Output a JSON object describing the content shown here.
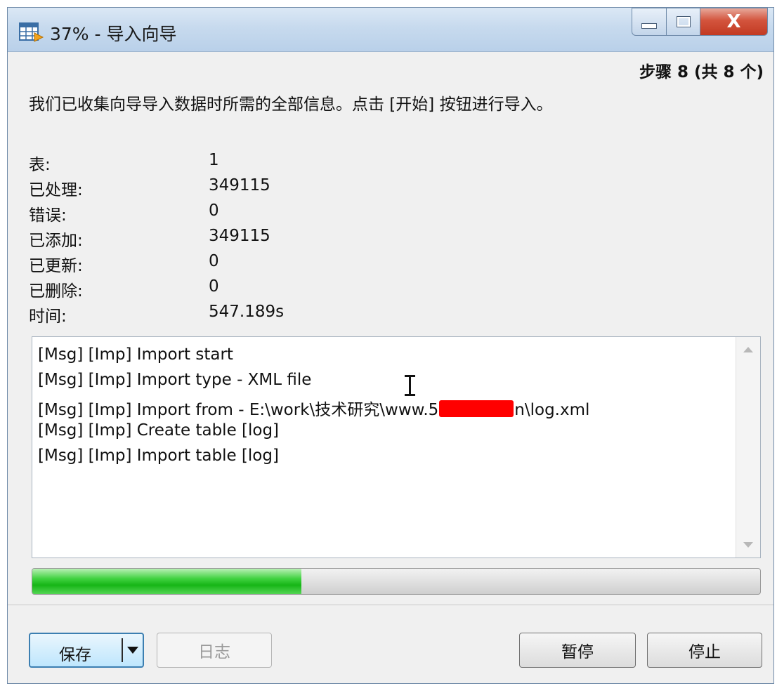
{
  "window": {
    "title": "37% - 导入向导",
    "app_icon": "grid-table-icon",
    "close_label": "X"
  },
  "wizard": {
    "step_label": "步骤 8 (共 8 个)",
    "description": "我们已收集向导导入数据时所需的全部信息。点击 [开始] 按钮进行导入。"
  },
  "stats": [
    {
      "label": "表:",
      "value": "1"
    },
    {
      "label": "已处理:",
      "value": "349115"
    },
    {
      "label": "错误:",
      "value": "0"
    },
    {
      "label": "已添加:",
      "value": "349115"
    },
    {
      "label": "已更新:",
      "value": "0"
    },
    {
      "label": "已删除:",
      "value": "0"
    },
    {
      "label": "时间:",
      "value": "547.189s"
    }
  ],
  "log": {
    "lines": [
      "[Msg] [Imp] Import start",
      "[Msg] [Imp] Import type - XML file",
      "[Msg] [Imp] Import from - E:\\work\\技术研究\\www.5",
      "[Msg] [Imp] Create table [log]",
      "[Msg] [Imp] Import table [log]"
    ],
    "line3_suffix": "n\\log.xml"
  },
  "progress": {
    "fraction": 0.37,
    "color": "#22c022"
  },
  "buttons": {
    "save": "保存",
    "log": "日志",
    "pause": "暂停",
    "stop": "停止"
  }
}
